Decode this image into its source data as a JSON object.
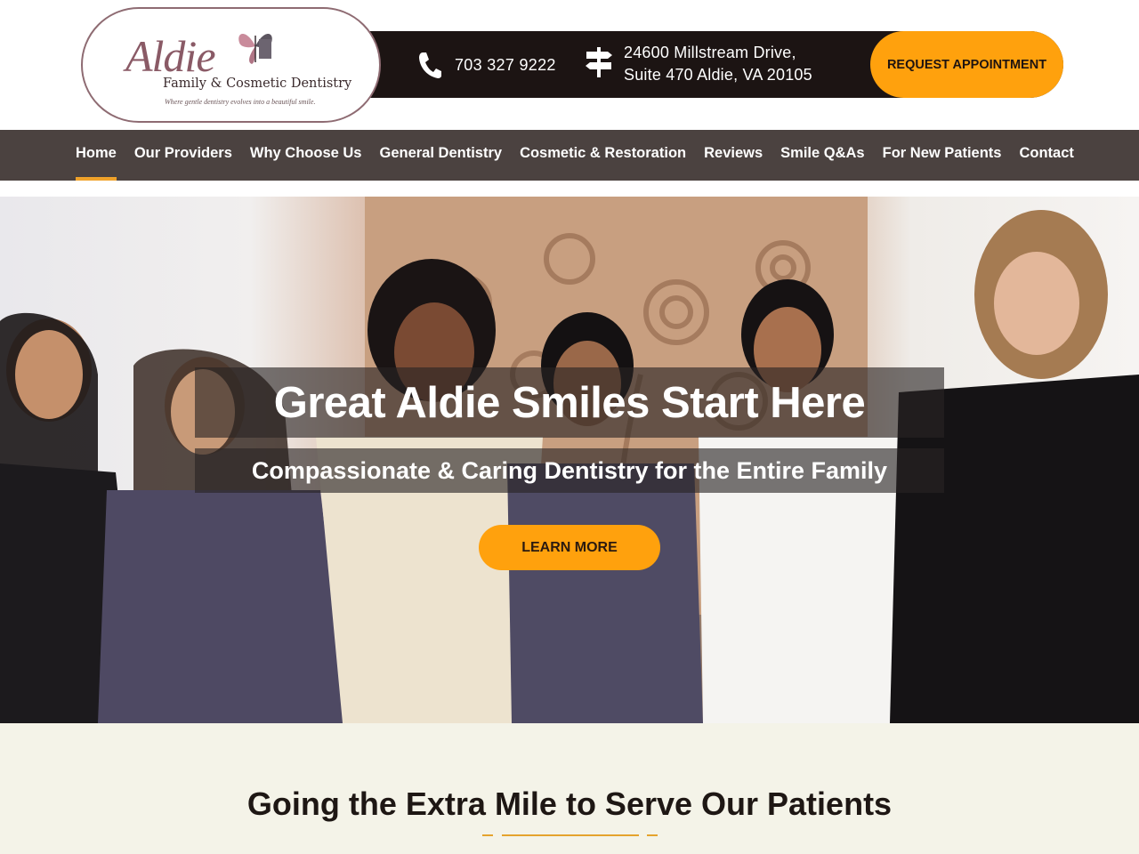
{
  "header": {
    "logo": {
      "script_text": "Aldie",
      "subtitle": "Family & Cosmetic Dentistry",
      "tagline": "Where gentle dentistry evolves into a beautiful smile."
    },
    "phone": {
      "icon": "phone-icon",
      "number": "703 327 9222"
    },
    "address": {
      "icon": "signpost-icon",
      "line1": "24600 Millstream Drive,",
      "line2": "Suite 470 Aldie, VA 20105"
    },
    "request_button": "REQUEST APPOINTMENT"
  },
  "nav": {
    "items": [
      {
        "label": "Home",
        "active": true
      },
      {
        "label": "Our Providers"
      },
      {
        "label": "Why Choose Us"
      },
      {
        "label": "General Dentistry"
      },
      {
        "label": "Cosmetic & Restoration"
      },
      {
        "label": "Reviews"
      },
      {
        "label": "Smile Q&As"
      },
      {
        "label": "For New Patients"
      },
      {
        "label": "Contact"
      }
    ]
  },
  "hero": {
    "title": "Great Aldie Smiles Start Here",
    "subtitle": "Compassionate & Caring Dentistry for the Entire Family",
    "button": "LEARN MORE"
  },
  "section": {
    "title": "Going the Extra Mile to Serve Our Patients"
  },
  "colors": {
    "accent": "#ffa10d",
    "nav_bg": "#4b4240",
    "contact_bar": "#1c1413",
    "section_bg": "#f4f3e8",
    "active_underline": "#f0a22a",
    "logo_border": "#8e6b72"
  }
}
